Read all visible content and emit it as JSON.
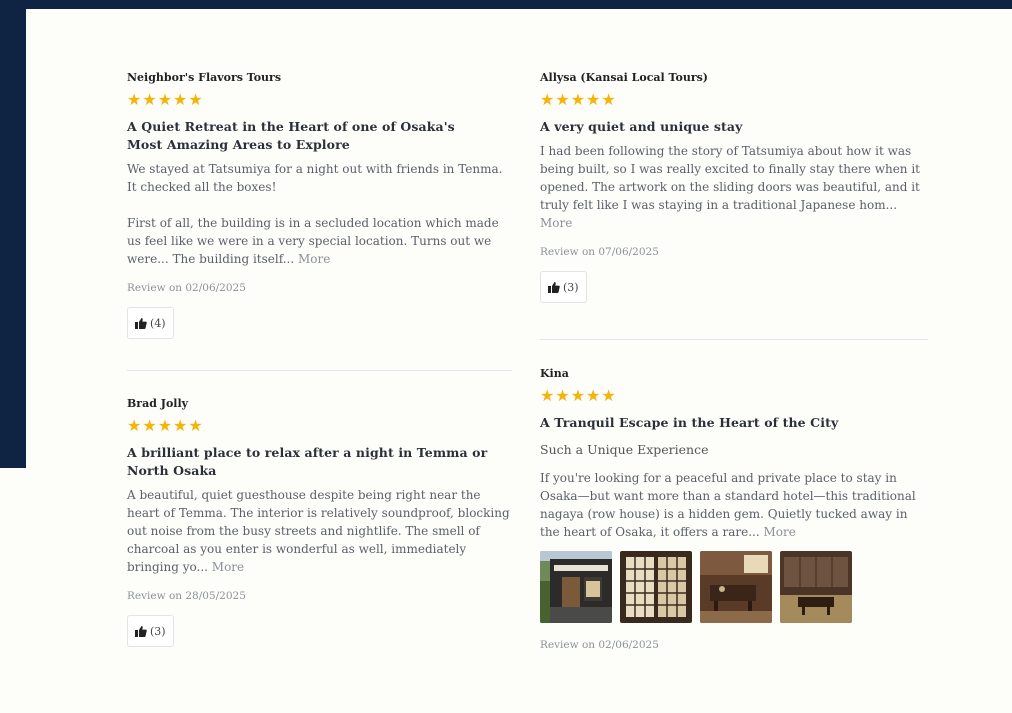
{
  "reviews": [
    {
      "reviewer": "Neighbor's Flavors Tours",
      "rating": 5,
      "title": "A Quiet Retreat in the Heart of one of Osaka's Most Amazing Areas to Explore",
      "para1": "We stayed at Tatsumiya for a night out with friends in Tenma. It checked all the boxes!",
      "para2": "First of all, the building is in a secluded location which made us feel like we were in a very special location. Turns out we were... The building itself...",
      "more": "More",
      "date": "Review on 02/06/2025",
      "likes": "(4)"
    },
    {
      "reviewer": "Brad Jolly",
      "rating": 5,
      "title": "A brilliant place to relax after a night in Temma or North Osaka",
      "para1": "A beautiful, quiet guesthouse despite being right near the heart of Temma. The interior is relatively soundproof, blocking out noise from the busy streets and nightlife. The smell of charcoal as you enter is wonderful as well, immediately bringing yo...",
      "more": "More",
      "date": "Review on 28/05/2025",
      "likes": "(3)"
    },
    {
      "reviewer": "Allysa (Kansai Local Tours)",
      "rating": 5,
      "title": "A very quiet and unique stay",
      "para1": "I had been following the story of Tatsumiya about how it was being built, so I was really excited to finally stay there when it opened. The artwork on the sliding doors was beautiful, and it truly felt like I was staying in a traditional Japanese hom...",
      "more": "More",
      "date": "Review on 07/06/2025",
      "likes": "(3)"
    },
    {
      "reviewer": "Kina",
      "rating": 5,
      "title": "A Tranquil Escape in the Heart of the City",
      "subtitle": "Such a Unique Experience",
      "para1": "If you're looking for a peaceful and private place to stay in Osaka—but want more than a standard hotel—this traditional nagaya (row house) is a hidden gem. Quietly tucked away in the heart of Osaka, it offers a rare...",
      "more": "More",
      "photos": [
        "storefront-photo",
        "shoji-door-photo",
        "dining-room-photo",
        "tatami-room-photo"
      ],
      "date": "Review on 02/06/2025"
    }
  ],
  "colors": {
    "navy": "#0f2442",
    "star": "#f5b40a",
    "background": "#fdfdfa"
  }
}
